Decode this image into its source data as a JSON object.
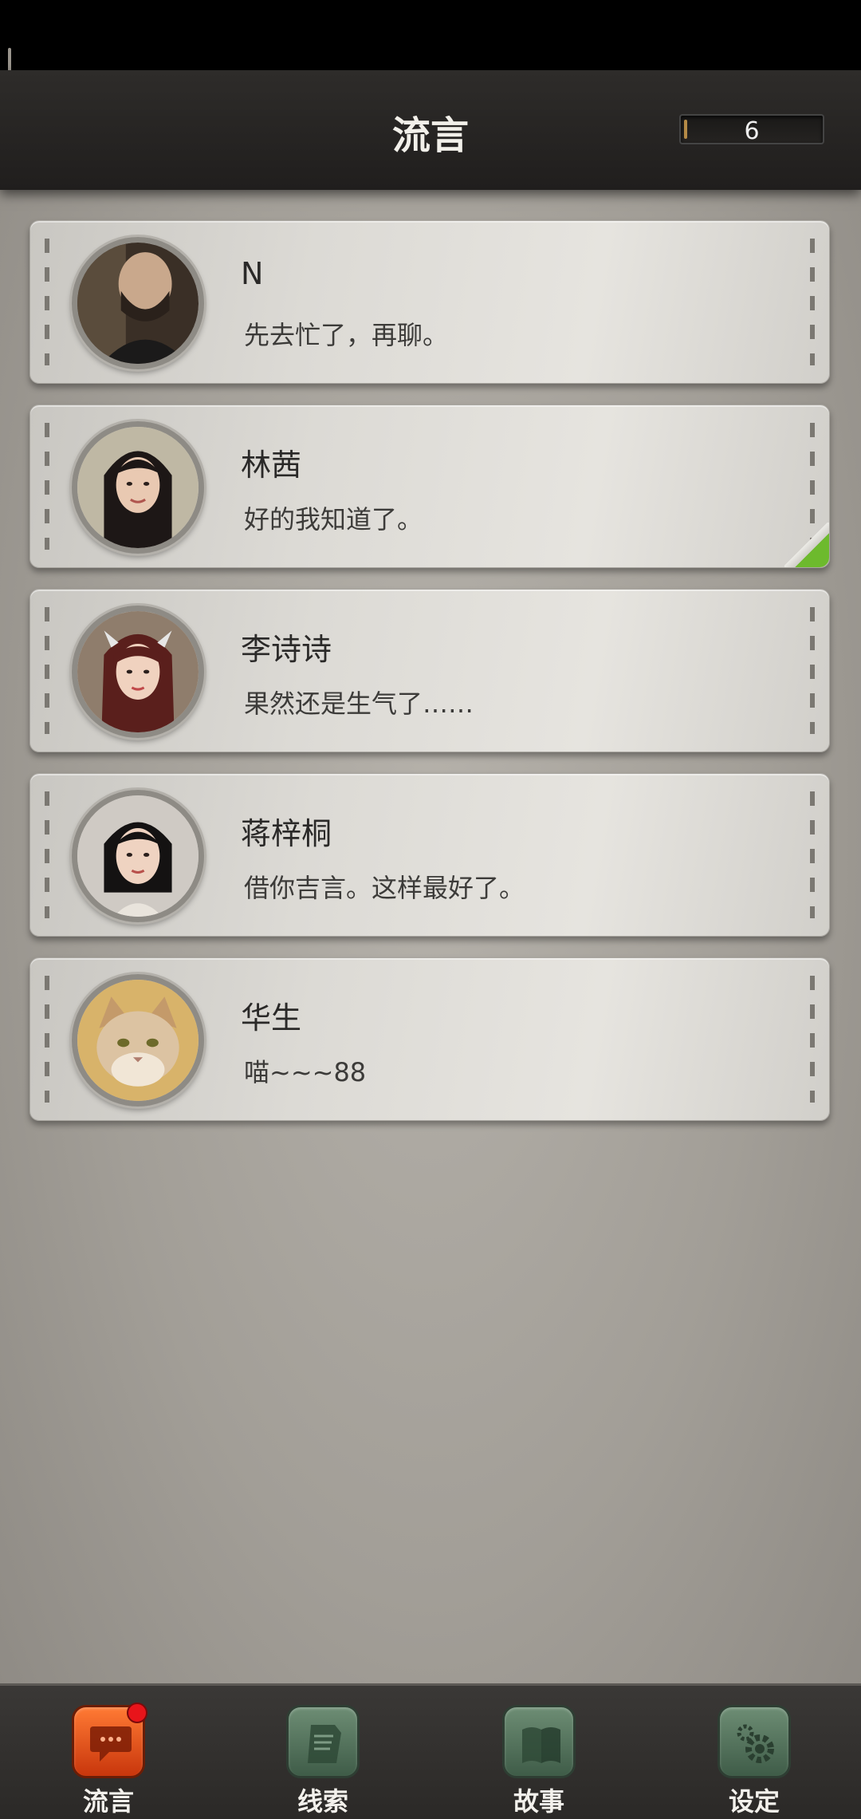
{
  "header": {
    "title": "流言",
    "counter": "6"
  },
  "messages": [
    {
      "name": "N",
      "preview": "先去忙了，再聊。",
      "avatar": "man-avatar"
    },
    {
      "name": "林茜",
      "preview": "好的我知道了。",
      "avatar": "woman-avatar"
    },
    {
      "name": "李诗诗",
      "preview": "果然还是生气了……",
      "avatar": "woman-avatar"
    },
    {
      "name": "蒋梓桐",
      "preview": "借你吉言。这样最好了。",
      "avatar": "woman-avatar"
    },
    {
      "name": "华生",
      "preview": "喵~~~88",
      "avatar": "cat-avatar"
    }
  ],
  "tabs": [
    {
      "label": "流言",
      "icon": "chat-bubble-icon",
      "active": true,
      "badge": true
    },
    {
      "label": "线索",
      "icon": "document-icon"
    },
    {
      "label": "故事",
      "icon": "book-icon"
    },
    {
      "label": "设定",
      "icon": "gear-icon"
    }
  ],
  "colors": {
    "accent": "#e8561d",
    "badge": "#e8141a",
    "unread_fold": "#6dba2d"
  }
}
